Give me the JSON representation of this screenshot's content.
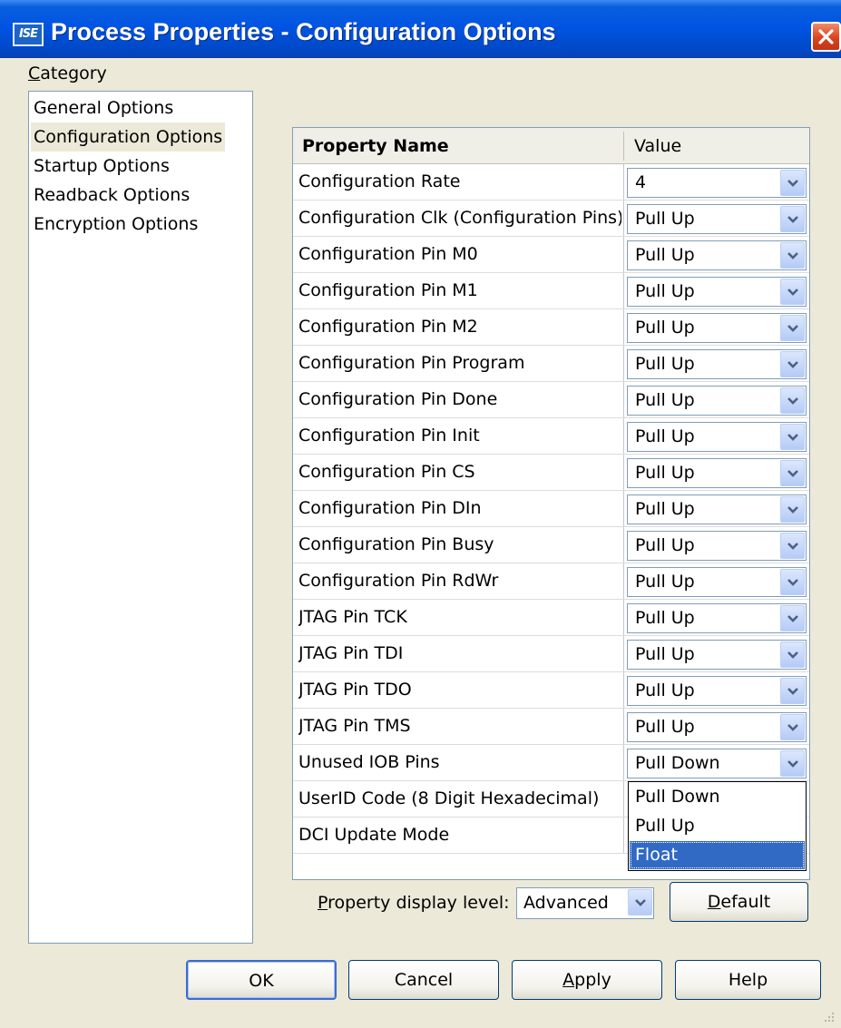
{
  "window": {
    "app_icon_text": "ISE",
    "title": "Process Properties - Configuration Options",
    "close_icon": "close-icon"
  },
  "category": {
    "label_accel": "C",
    "label_rest": "ategory",
    "items": [
      {
        "label": "General Options",
        "selected": false
      },
      {
        "label": "Configuration Options",
        "selected": true
      },
      {
        "label": "Startup Options",
        "selected": false
      },
      {
        "label": "Readback Options",
        "selected": false
      },
      {
        "label": "Encryption Options",
        "selected": false
      }
    ]
  },
  "grid": {
    "header_name": "Property Name",
    "header_value": "Value",
    "rows": [
      {
        "name": "Configuration Rate",
        "value": "4"
      },
      {
        "name": "Configuration Clk (Configuration Pins)",
        "value": "Pull Up"
      },
      {
        "name": "Configuration Pin M0",
        "value": "Pull Up"
      },
      {
        "name": "Configuration Pin M1",
        "value": "Pull Up"
      },
      {
        "name": "Configuration Pin M2",
        "value": "Pull Up"
      },
      {
        "name": "Configuration Pin Program",
        "value": "Pull Up"
      },
      {
        "name": "Configuration Pin Done",
        "value": "Pull Up"
      },
      {
        "name": "Configuration Pin Init",
        "value": "Pull Up"
      },
      {
        "name": "Configuration Pin CS",
        "value": "Pull Up"
      },
      {
        "name": "Configuration Pin DIn",
        "value": "Pull Up"
      },
      {
        "name": "Configuration Pin Busy",
        "value": "Pull Up"
      },
      {
        "name": "Configuration Pin RdWr",
        "value": "Pull Up"
      },
      {
        "name": "JTAG Pin TCK",
        "value": "Pull Up"
      },
      {
        "name": "JTAG Pin TDI",
        "value": "Pull Up"
      },
      {
        "name": "JTAG Pin TDO",
        "value": "Pull Up"
      },
      {
        "name": "JTAG Pin TMS",
        "value": "Pull Up"
      },
      {
        "name": "Unused IOB Pins",
        "value": "Pull Down"
      },
      {
        "name": "UserID Code (8 Digit Hexadecimal)",
        "value": ""
      },
      {
        "name": "DCI Update Mode",
        "value": ""
      }
    ],
    "open_dropdown": {
      "options": [
        "Pull Down",
        "Pull Up",
        "Float"
      ],
      "highlighted": "Float"
    }
  },
  "display_level": {
    "label_accel": "P",
    "label_rest": "roperty display level:",
    "value": "Advanced"
  },
  "buttons": {
    "default_accel": "D",
    "default_rest": "efault",
    "ok": "OK",
    "cancel": "Cancel",
    "apply_accel": "A",
    "apply_rest": "pply",
    "help": "Help"
  },
  "colors": {
    "titlebar": "#0054e3",
    "dialog_bg": "#ece9d8",
    "selection": "#316ac5",
    "close_button": "#d9441d"
  }
}
